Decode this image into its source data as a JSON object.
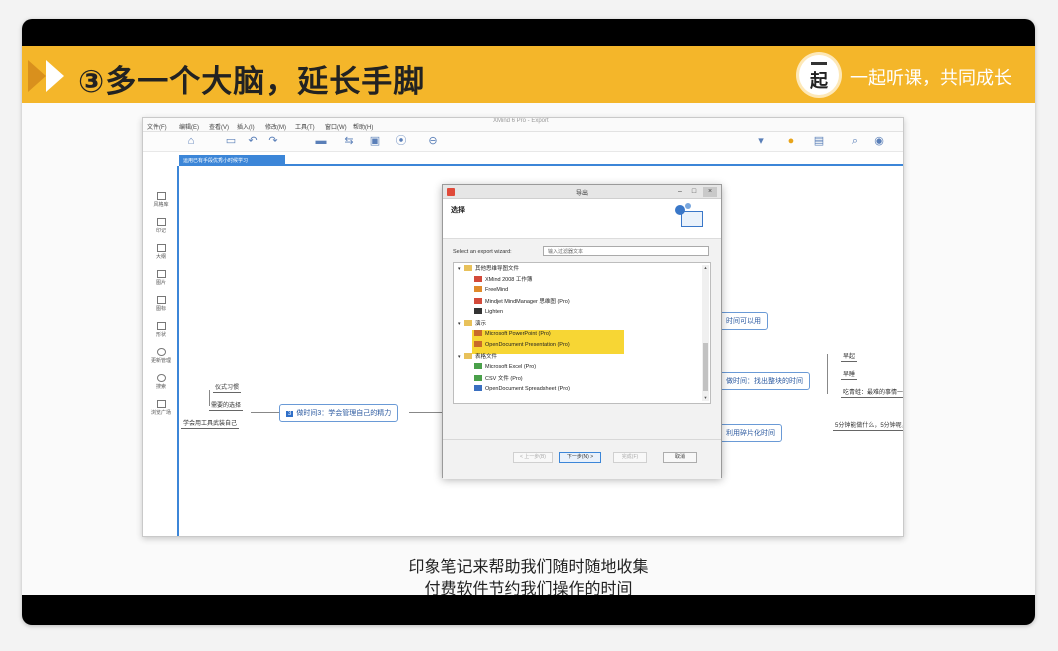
{
  "header": {
    "title": "③多一个大脑，延长手脚",
    "logo_char": "起",
    "slogan": "一起听课，共同成长"
  },
  "subtitles": {
    "line1": "印象笔记来帮助我们随时随地收集",
    "line2": "付费软件节约我们操作的时间"
  },
  "app": {
    "window_title": "XMind 6 Pro - Export",
    "menu": [
      "文件(F)",
      "编辑(E)",
      "查看(V)",
      "插入(I)",
      "修改(M)",
      "工具(T)",
      "窗口(W)",
      "帮助(H)"
    ],
    "tab_label": "运用已有手段优秀小时候学习"
  },
  "sidebar": {
    "items": [
      {
        "label": "风格库",
        "icon": "style-icon"
      },
      {
        "label": "印记",
        "icon": "marker-icon"
      },
      {
        "label": "大纲",
        "icon": "outline-icon"
      },
      {
        "label": "图片",
        "icon": "image-icon"
      },
      {
        "label": "图标",
        "icon": "icon-icon"
      },
      {
        "label": "形状",
        "icon": "shape-icon"
      },
      {
        "label": "更新管理",
        "icon": "refresh-icon"
      },
      {
        "label": "搜索",
        "icon": "search-icon"
      },
      {
        "label": "浏览广场",
        "icon": "grid-icon"
      }
    ]
  },
  "mindmap": {
    "node_habit": "仪式习惯",
    "node_choice": "需要的选择",
    "node_tools": "学会用工具武装自己",
    "main_topic": "做时间3：学会管理自己的精力",
    "main_topic_num": "3",
    "node_right1": "时间可以用",
    "node_right2": "做时间：找出整块的时间",
    "node_right3": "利用碎片化时间",
    "leaf_early": "早起",
    "leaf_sleep": "早睡",
    "leaf_eat": "吃青蛙：最难的事情一大早",
    "leaf_five": "5分钟能做什么，5分钟呢，5分钟"
  },
  "dialog": {
    "title": "导出",
    "heading": "选择",
    "wizard_label": "Select an export wizard:",
    "wizard_placeholder": "输入过滤器文本",
    "tree": [
      {
        "label": "其他思维导图文件",
        "indent": 0,
        "twisty": "▾",
        "icon": "folder"
      },
      {
        "label": "XMind 2008 工作簿",
        "indent": 1,
        "twisty": "",
        "icon": "red"
      },
      {
        "label": "FreeMind",
        "indent": 1,
        "twisty": "",
        "icon": "orange"
      },
      {
        "label": "Mindjet MindManager 思维图 (Pro)",
        "indent": 1,
        "twisty": "",
        "icon": "red"
      },
      {
        "label": "Lighten",
        "indent": 1,
        "twisty": "",
        "icon": "dark"
      },
      {
        "label": "演示",
        "indent": 0,
        "twisty": "▾",
        "icon": "folder"
      },
      {
        "label": "Microsoft PowerPoint (Pro)",
        "indent": 1,
        "twisty": "",
        "icon": "pp"
      },
      {
        "label": "OpenDocument Presentation (Pro)",
        "indent": 1,
        "twisty": "",
        "icon": "pp"
      },
      {
        "label": "表格文件",
        "indent": 0,
        "twisty": "▾",
        "icon": "folder"
      },
      {
        "label": "Microsoft Excel (Pro)",
        "indent": 1,
        "twisty": "",
        "icon": "green"
      },
      {
        "label": "CSV 文件 (Pro)",
        "indent": 1,
        "twisty": "",
        "icon": "green"
      },
      {
        "label": "OpenDocument Spreadsheet (Pro)",
        "indent": 1,
        "twisty": "",
        "icon": "blue"
      }
    ],
    "buttons": {
      "back": "< 上一步(B)",
      "next": "下一步(N) >",
      "finish": "完成(F)",
      "cancel": "取消"
    },
    "highlight_color": "#f7d634"
  },
  "colors": {
    "header_bg": "#f4b62a",
    "accent_blue": "#3c86d8"
  }
}
